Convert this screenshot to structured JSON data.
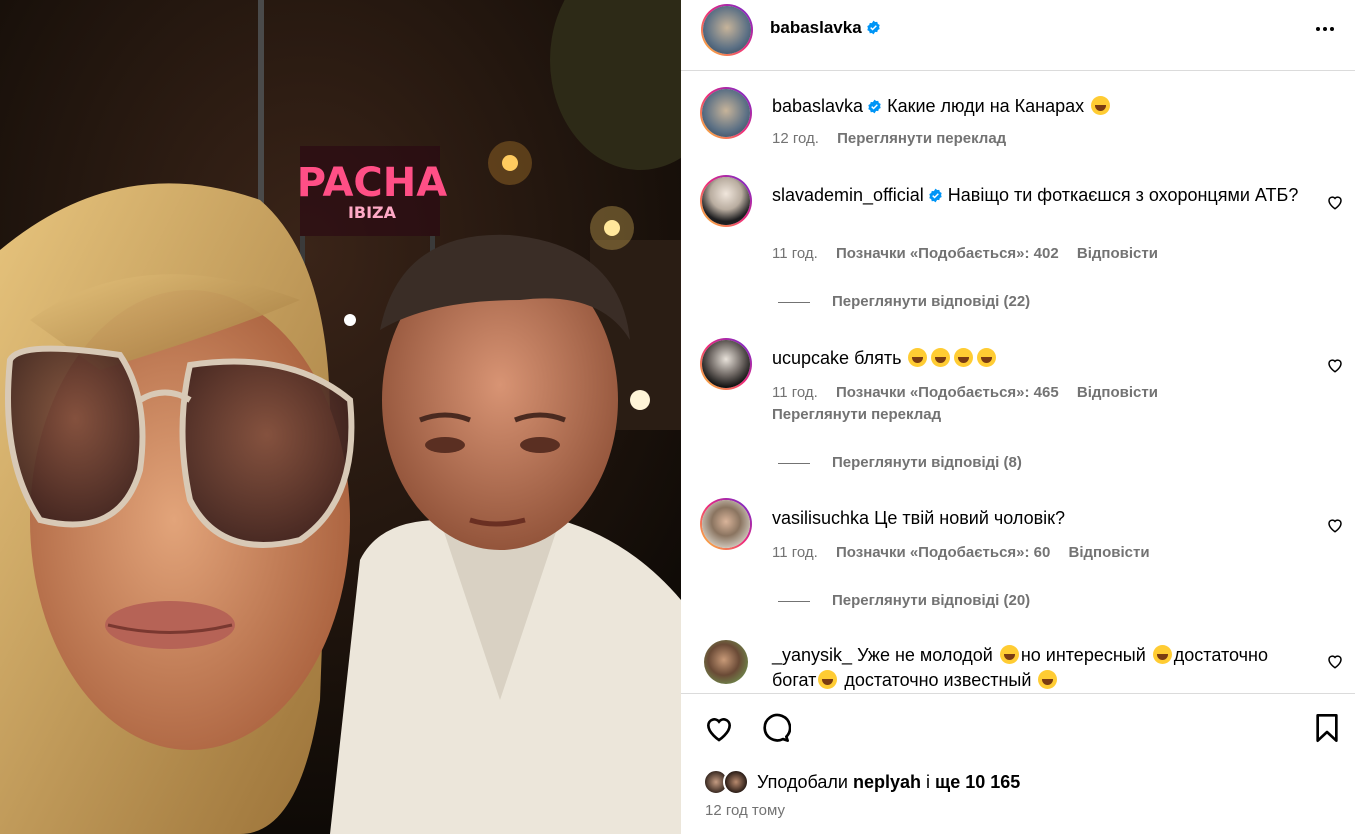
{
  "post": {
    "author": "babaslavka",
    "caption": {
      "username": "babaslavka",
      "text": "Какие люди на Канарах",
      "time": "12 год.",
      "translate": "Переглянути переклад"
    },
    "comments": [
      {
        "username": "slavademin_official",
        "verified": true,
        "text": "Навіщо ти фоткаєшся з охоронцями АТБ?",
        "time": "11 год.",
        "likes": "Позначки «Подобається»: 402",
        "reply": "Відповісти",
        "view_replies": "Переглянути відповіді (22)"
      },
      {
        "username": "ucupcake",
        "text": "блять",
        "time": "11 год.",
        "likes": "Позначки «Подобається»: 465",
        "reply": "Відповісти",
        "translate": "Переглянути переклад",
        "view_replies": "Переглянути відповіді (8)"
      },
      {
        "username": "vasilisuchka",
        "text": "Це твій новий чоловік?",
        "time": "11 год.",
        "likes": "Позначки «Подобається»: 60",
        "reply": "Відповісти",
        "view_replies": "Переглянути відповіді (20)"
      },
      {
        "username": "_yanysik_",
        "text_parts": [
          "Уже не молодой",
          "но интересный",
          "достаточно богат",
          "достаточно известный"
        ]
      }
    ],
    "likes_summary": {
      "prefix": "Уподобали",
      "user": "neplyah",
      "middle": "і",
      "rest": "ще 10 165"
    },
    "posted_time": "12 год тому",
    "photo_sign": {
      "line1": "PACHA",
      "line2": "IBIZA"
    },
    "colors": {
      "verified": "#0095f6",
      "meta_gray": "#737373",
      "neon_sign": "#ff3d7f"
    },
    "icons": [
      "verified-badge-icon",
      "more-options-icon",
      "heart-icon",
      "comment-icon",
      "bookmark-icon"
    ]
  }
}
